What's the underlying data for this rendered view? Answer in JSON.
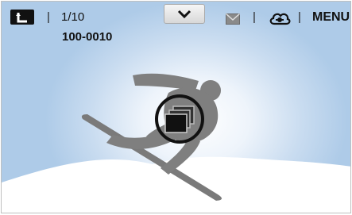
{
  "header": {
    "counter": "1/10",
    "file_number": "100-0010",
    "menu_label": "MENU",
    "separators": [
      "|",
      "|",
      "|"
    ]
  },
  "icons": {
    "back": "back-arrow-icon",
    "dropdown": "chevron-down-icon",
    "mail": "envelope-icon",
    "share": "cloud-share-icon",
    "group": "photo-group-icon"
  },
  "colors": {
    "sky": "#aecbe8",
    "silhouette": "#7f7f7f",
    "icon_dark": "#111111"
  }
}
